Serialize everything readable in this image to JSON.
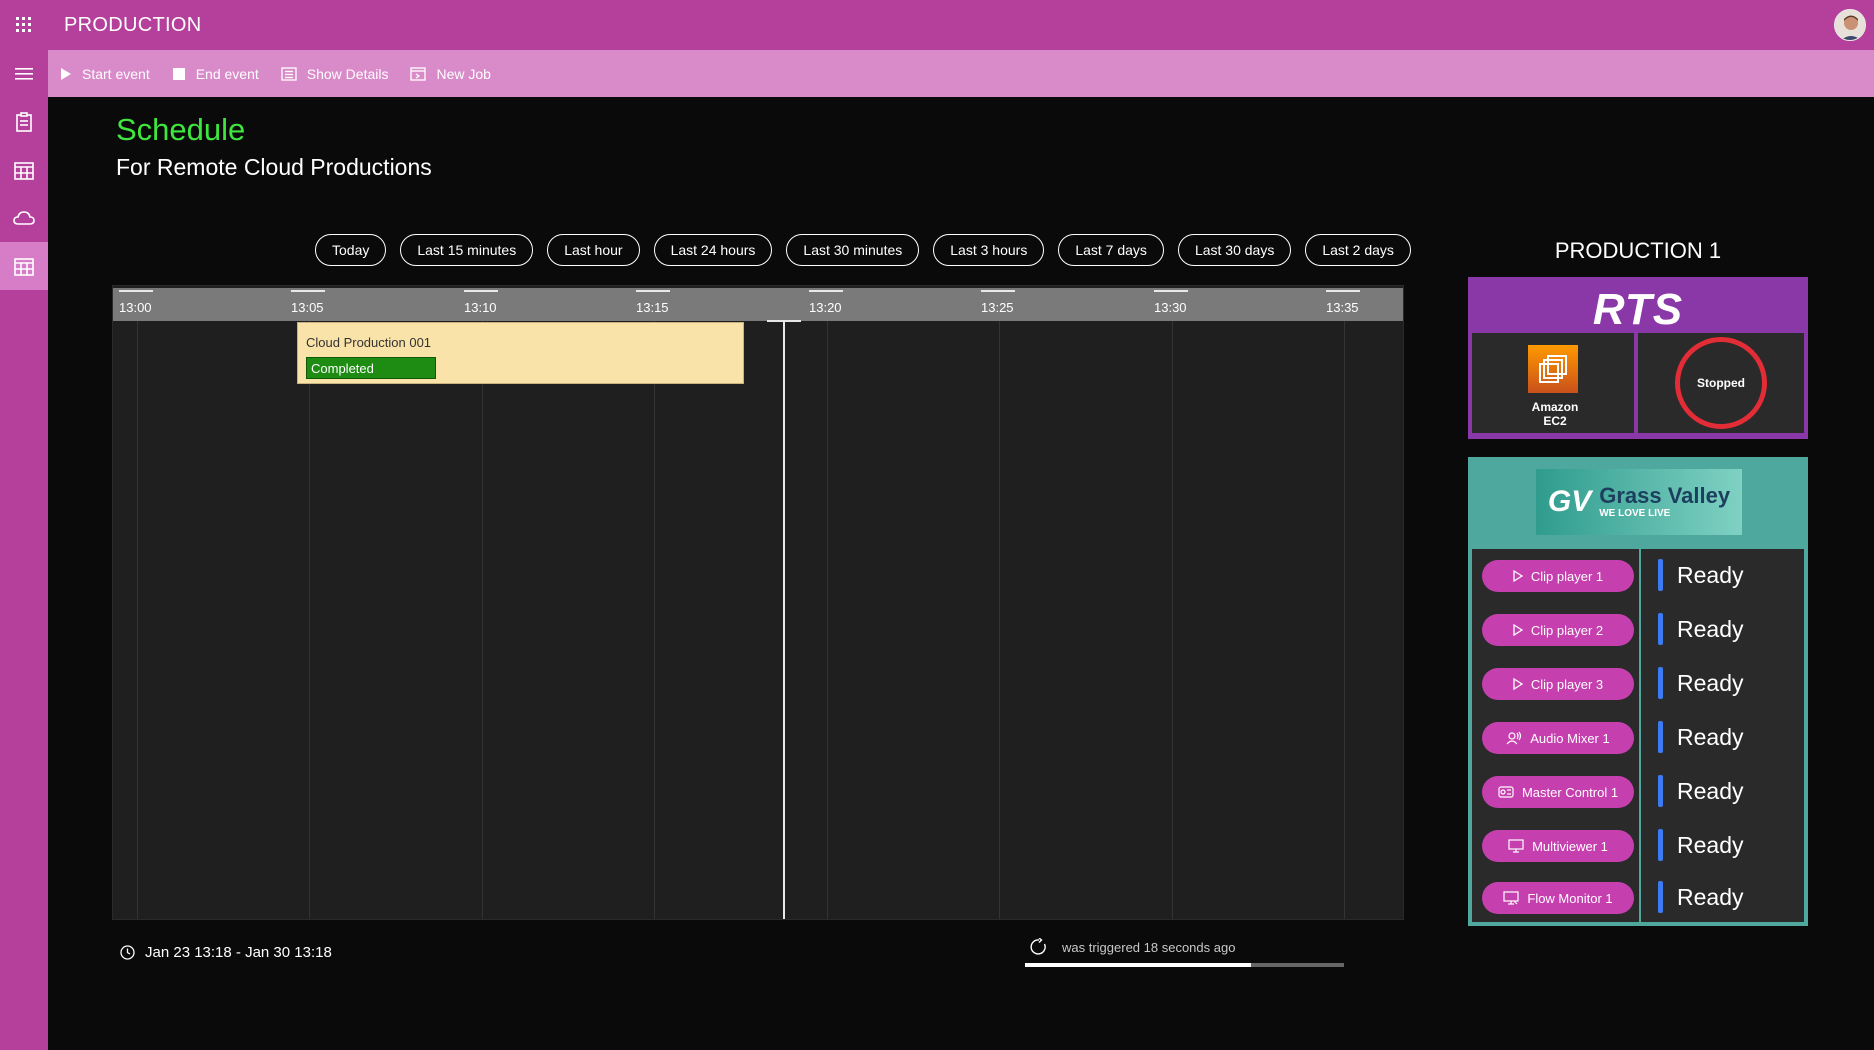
{
  "app": {
    "title": "PRODUCTION"
  },
  "toolbar": {
    "start_event": "Start event",
    "end_event": "End event",
    "show_details": "Show Details",
    "new_job": "New Job"
  },
  "page": {
    "title": "Schedule",
    "subtitle": "For Remote Cloud Productions"
  },
  "filters": [
    "Today",
    "Last 15 minutes",
    "Last hour",
    "Last 24 hours",
    "Last 30 minutes",
    "Last 3 hours",
    "Last 7 days",
    "Last 30 days",
    "Last 2 days"
  ],
  "timeline": {
    "ticks": [
      "13:00",
      "13:05",
      "13:10",
      "13:15",
      "13:20",
      "13:25",
      "13:30",
      "13:35"
    ],
    "event": {
      "title": "Cloud Production 001",
      "status": "Completed"
    }
  },
  "footer": {
    "date_range": "Jan 23 13:18 - Jan 30 13:18",
    "trigger_text": "was triggered 18 seconds ago",
    "progress": 0.71
  },
  "production": {
    "title": "PRODUCTION 1",
    "rts_logo": "RTS",
    "ec2_label_line1": "Amazon",
    "ec2_label_line2": "EC2",
    "rts_status": "Stopped",
    "gv_logo_main": "Grass Valley",
    "gv_logo_tag": "WE LOVE LIVE",
    "gv_logo_mark": "GV",
    "devices": [
      {
        "label": "Clip player 1",
        "icon": "play-icon",
        "status": "Ready"
      },
      {
        "label": "Clip player 2",
        "icon": "play-icon",
        "status": "Ready"
      },
      {
        "label": "Clip player 3",
        "icon": "play-icon",
        "status": "Ready"
      },
      {
        "label": "Audio Mixer 1",
        "icon": "audio-icon",
        "status": "Ready"
      },
      {
        "label": "Master Control 1",
        "icon": "control-icon",
        "status": "Ready"
      },
      {
        "label": "Multiviewer 1",
        "icon": "monitor-icon",
        "status": "Ready"
      },
      {
        "label": "Flow Monitor 1",
        "icon": "flow-monitor-icon",
        "status": "Ready"
      }
    ]
  },
  "colors": {
    "brand": "#b4409b",
    "command_bar": "#d98ac9",
    "heading": "#3ee63e",
    "event_bg": "#fae3a8",
    "completed": "#1e8b12",
    "rts": "#8a37a8",
    "stopped": "#e22c36",
    "gv": "#4ea89d",
    "device_btn": "#c53fae",
    "ready_bar": "#3d7bf5"
  }
}
